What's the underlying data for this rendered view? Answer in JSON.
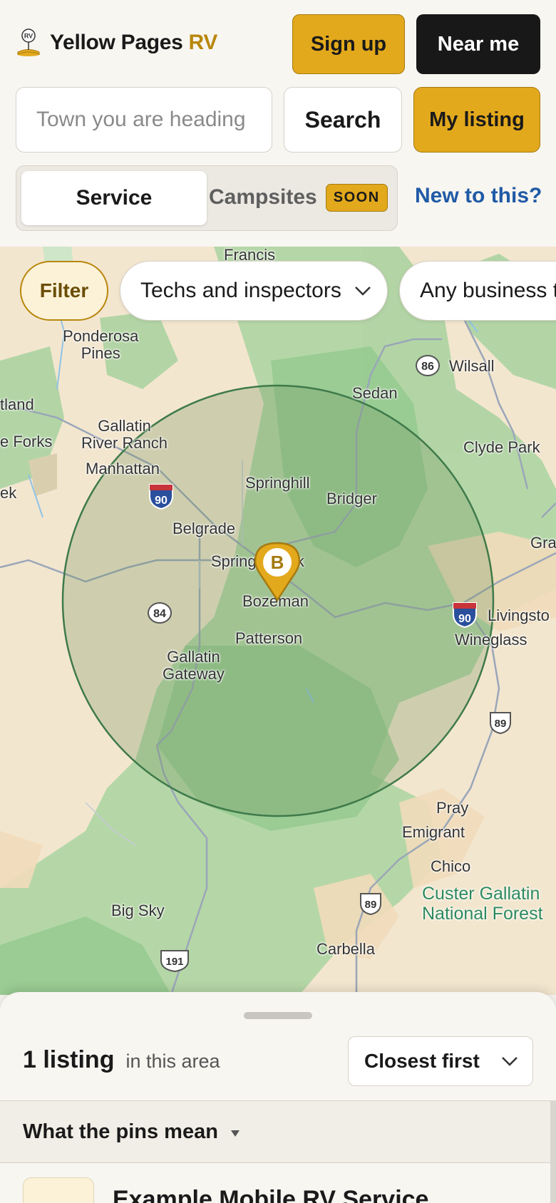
{
  "header": {
    "logo_name": "Yellow Pages",
    "logo_accent": "RV",
    "logo_badge": "RV",
    "signup_label": "Sign up",
    "nearme_label": "Near me",
    "search_placeholder": "Town you are heading to",
    "search_label": "Search",
    "mylisting_label": "My listing"
  },
  "segment": {
    "service_label": "Service",
    "campsites_label": "Campsites",
    "soon_badge": "SOON",
    "help_link": "New to this?"
  },
  "filters": {
    "filter_label": "Filter",
    "type_label": "Techs and inspectors",
    "business_label": "Any business type"
  },
  "map": {
    "pin_letter": "B",
    "labels": {
      "francis": "Francis",
      "ponderosa": "Ponderosa\nPines",
      "wilsall": "Wilsall",
      "sedan": "Sedan",
      "tland": "tland",
      "gallatin_river_ranch": "Gallatin\nRiver Ranch",
      "forks": "e Forks",
      "clyde_park": "Clyde Park",
      "manhattan": "Manhattan",
      "springhill": "Springhill",
      "bridger": "Bridger",
      "ek": "ek",
      "belgrade": "Belgrade",
      "gra": "Gra",
      "spring_creek_park": "Spring      ark",
      "bozeman": "Bozeman",
      "livingston": "Livingsto",
      "patterson": "Patterson",
      "wineglass": "Wineglass",
      "gallatin_gateway": "Gallatin\nGateway",
      "pray": "Pray",
      "emigrant": "Emigrant",
      "chico": "Chico",
      "custer": "Custer Gallatin\nNational Forest",
      "big_sky": "Big Sky",
      "carbella": "Carbella"
    },
    "shields": {
      "i90_west": "90",
      "i90_east": "90",
      "r86": "86",
      "r84": "84",
      "r89_north": "89",
      "r89_south": "89",
      "r191": "191"
    }
  },
  "sheet": {
    "count": "1 listing",
    "count_suffix": "in this area",
    "sort_label": "Closest first",
    "legend_label": "What the pins mean",
    "first_listing": "Example Mobile RV Service"
  },
  "colors": {
    "accent": "#e3a91c",
    "accent_border": "#a57a10",
    "link": "#1f5aa6",
    "radius_fill": "#6f8f5f",
    "radius_stroke": "#3f7a4a"
  }
}
